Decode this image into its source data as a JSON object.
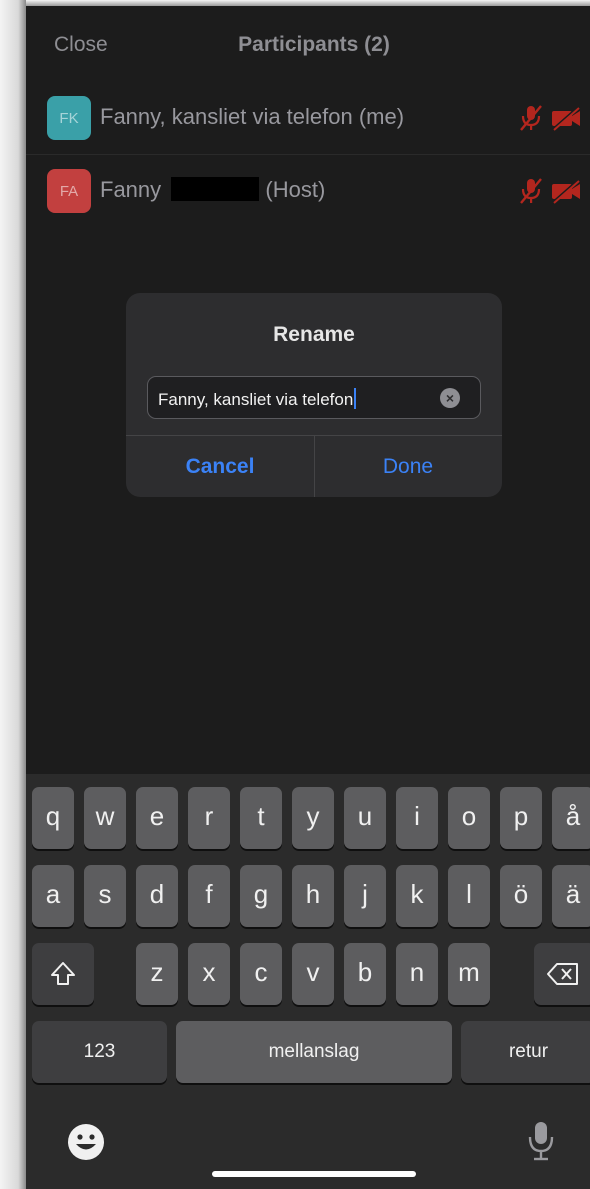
{
  "header": {
    "close_label": "Close",
    "title": "Participants (2)"
  },
  "participants": [
    {
      "initials": "FK",
      "name": "Fanny, kansliet via telefon (me)",
      "avatar_color": "#3aa0a8",
      "muted": true,
      "video_off": true
    },
    {
      "initials": "FA",
      "name_prefix": "Fanny",
      "name_suffix": "(Host)",
      "avatar_color": "#c2403f",
      "muted": true,
      "video_off": true
    }
  ],
  "dialog": {
    "title": "Rename",
    "input_value": "Fanny, kansliet via telefon",
    "cancel_label": "Cancel",
    "done_label": "Done"
  },
  "keyboard": {
    "row1": [
      "q",
      "w",
      "e",
      "r",
      "t",
      "y",
      "u",
      "i",
      "o",
      "p",
      "å"
    ],
    "row2": [
      "a",
      "s",
      "d",
      "f",
      "g",
      "h",
      "j",
      "k",
      "l",
      "ö",
      "ä"
    ],
    "row3": [
      "z",
      "x",
      "c",
      "v",
      "b",
      "n",
      "m"
    ],
    "numbers_label": "123",
    "space_label": "mellanslag",
    "return_label": "retur"
  },
  "colors": {
    "accent": "#3b82f6",
    "muted_red": "#b3261e"
  }
}
